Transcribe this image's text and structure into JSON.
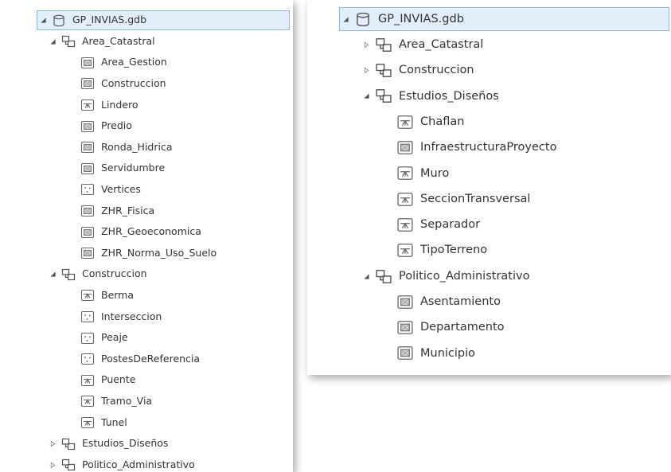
{
  "left_tree": {
    "root": {
      "label": "GP_INVIAS.gdb",
      "expanded": true,
      "icon": "database-icon"
    },
    "datasets": [
      {
        "label": "Area_Catastral",
        "expanded": true,
        "icon": "feature-dataset-icon",
        "children": [
          {
            "label": "Area_Gestion",
            "icon": "polygon-feature-class-icon"
          },
          {
            "label": "Construccion",
            "icon": "polygon-feature-class-icon"
          },
          {
            "label": "Lindero",
            "icon": "line-feature-class-icon"
          },
          {
            "label": "Predio",
            "icon": "polygon-feature-class-icon"
          },
          {
            "label": "Ronda_Hidrica",
            "icon": "polygon-feature-class-icon"
          },
          {
            "label": "Servidumbre",
            "icon": "polygon-feature-class-icon"
          },
          {
            "label": "Vertices",
            "icon": "point-feature-class-icon"
          },
          {
            "label": "ZHR_Fisica",
            "icon": "polygon-feature-class-icon"
          },
          {
            "label": "ZHR_Geoeconomica",
            "icon": "polygon-feature-class-icon"
          },
          {
            "label": "ZHR_Norma_Uso_Suelo",
            "icon": "polygon-feature-class-icon"
          }
        ]
      },
      {
        "label": "Construccion",
        "expanded": true,
        "icon": "feature-dataset-icon",
        "children": [
          {
            "label": "Berma",
            "icon": "line-feature-class-icon"
          },
          {
            "label": "Interseccion",
            "icon": "point-feature-class-icon"
          },
          {
            "label": "Peaje",
            "icon": "point-feature-class-icon"
          },
          {
            "label": "PostesDeReferencia",
            "icon": "point-feature-class-icon"
          },
          {
            "label": "Puente",
            "icon": "line-feature-class-icon"
          },
          {
            "label": "Tramo_Via",
            "icon": "line-feature-class-icon"
          },
          {
            "label": "Tunel",
            "icon": "line-feature-class-icon"
          }
        ]
      },
      {
        "label": "Estudios_Diseños",
        "expanded": false,
        "icon": "feature-dataset-icon",
        "children": []
      },
      {
        "label": "Politico_Administrativo",
        "expanded": false,
        "icon": "feature-dataset-icon",
        "children": []
      }
    ]
  },
  "right_tree": {
    "root": {
      "label": "GP_INVIAS.gdb",
      "expanded": true,
      "icon": "database-icon"
    },
    "datasets": [
      {
        "label": "Area_Catastral",
        "expanded": false,
        "icon": "feature-dataset-icon",
        "children": []
      },
      {
        "label": "Construccion",
        "expanded": false,
        "icon": "feature-dataset-icon",
        "children": []
      },
      {
        "label": "Estudios_Diseños",
        "expanded": true,
        "icon": "feature-dataset-icon",
        "children": [
          {
            "label": "Chaflan",
            "icon": "line-feature-class-icon"
          },
          {
            "label": "InfraestructuraProyecto",
            "icon": "polygon-feature-class-icon"
          },
          {
            "label": "Muro",
            "icon": "line-feature-class-icon"
          },
          {
            "label": "SeccionTransversal",
            "icon": "line-feature-class-icon"
          },
          {
            "label": "Separador",
            "icon": "line-feature-class-icon"
          },
          {
            "label": "TipoTerreno",
            "icon": "line-feature-class-icon"
          }
        ]
      },
      {
        "label": "Politico_Administrativo",
        "expanded": true,
        "icon": "feature-dataset-icon",
        "children": [
          {
            "label": "Asentamiento",
            "icon": "polygon-feature-class-icon"
          },
          {
            "label": "Departamento",
            "icon": "polygon-feature-class-icon"
          },
          {
            "label": "Municipio",
            "icon": "polygon-feature-class-icon"
          }
        ]
      }
    ]
  },
  "colors": {
    "selection_fill": "#e2eef9",
    "selection_border": "#8fb6dd",
    "text": "#333333",
    "icon_stroke": "#555555"
  }
}
